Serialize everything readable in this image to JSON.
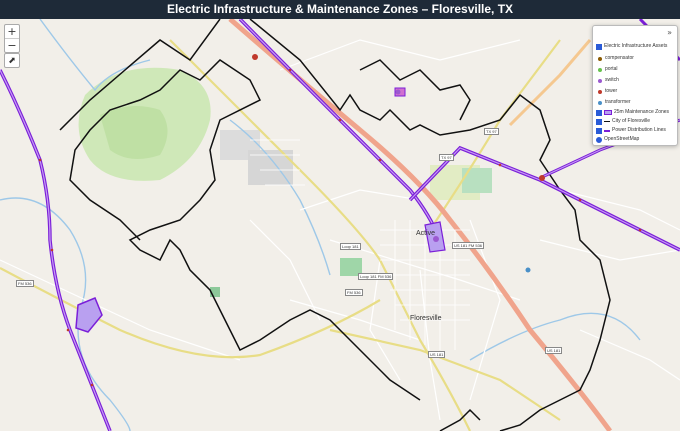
{
  "title": "Electric Infrastructure & Maintenance Zones – Floresville, TX",
  "controls": {
    "zoom_in": "+",
    "zoom_out": "−",
    "measure": "⬈"
  },
  "legend": {
    "collapse_glyph": "»",
    "group_label": "Electric Infrastructure Assets",
    "assets": [
      {
        "label": "compensator",
        "color": "#8a5a00"
      },
      {
        "label": "portal",
        "color": "#66c24c"
      },
      {
        "label": "switch",
        "color": "#9b59d0"
      },
      {
        "label": "tower",
        "color": "#c0392b"
      },
      {
        "label": "transformer",
        "color": "#4a90c8"
      }
    ],
    "layers": [
      {
        "label": "25m Maintenance Zones",
        "swatch": "zone"
      },
      {
        "label": "City of Floresville",
        "swatch": "city"
      },
      {
        "label": "Power Distribution Lines",
        "swatch": "power"
      },
      {
        "label": "OpenStreetMap",
        "swatch": "none"
      }
    ]
  },
  "map_labels": {
    "active": "Active",
    "town": "Floresville",
    "loop181_a": "Loop 181",
    "loop181_b": "Loop 181 FM 536",
    "fm536": "FM 536",
    "fm536_b": "FM 536",
    "us181_a": "US 181 FM 536",
    "us181_b": "US 181",
    "tx97_a": "TX 97",
    "tx97_b": "TX 97",
    "us181_c": "US 181"
  },
  "colors": {
    "power_line": "#7b1fd8",
    "zone_fill": "#b9a0f0",
    "city_boundary": "#111111",
    "road_major": "#f0a48c",
    "road_secondary": "#e8dd86",
    "title_bg": "#1e2a38"
  }
}
